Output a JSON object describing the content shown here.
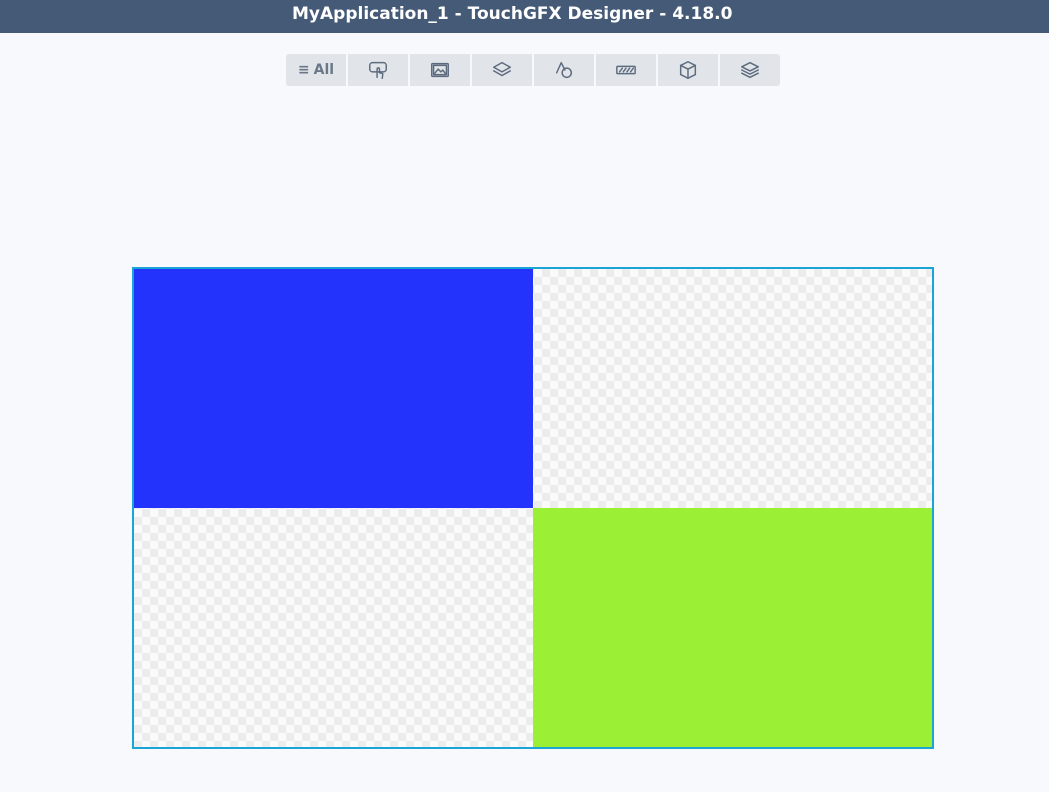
{
  "window": {
    "title": "MyApplication_1 - TouchGFX Designer - 4.18.0"
  },
  "toolbar": {
    "all_label": "All",
    "buttons": [
      {
        "icon": "list-icon",
        "label": "All"
      },
      {
        "icon": "touch-icon"
      },
      {
        "icon": "image-icon"
      },
      {
        "icon": "container-icon"
      },
      {
        "icon": "shapes-icon"
      },
      {
        "icon": "progress-icon"
      },
      {
        "icon": "3d-box-icon"
      },
      {
        "icon": "layers-icon"
      }
    ]
  },
  "canvas": {
    "widgets": [
      {
        "name": "blue-box",
        "color": "#2333fb"
      },
      {
        "name": "green-box",
        "color": "#9bf035"
      }
    ]
  }
}
